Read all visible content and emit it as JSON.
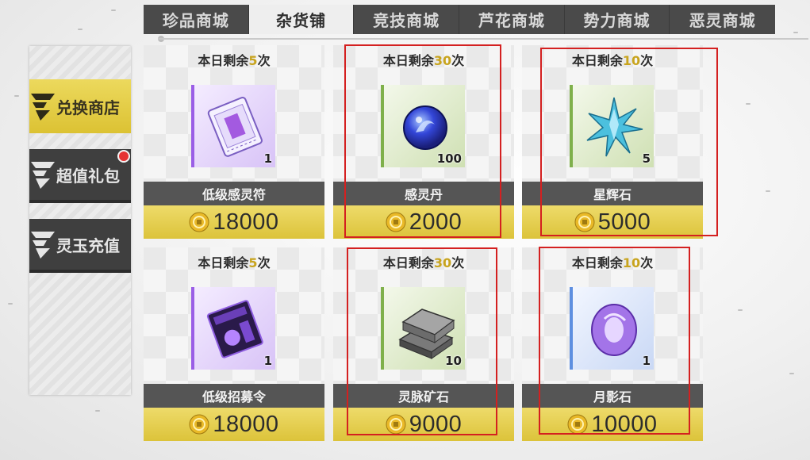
{
  "tabs": [
    {
      "label": "珍品商城"
    },
    {
      "label": "杂货铺"
    },
    {
      "label": "竞技商城"
    },
    {
      "label": "芦花商城"
    },
    {
      "label": "势力商城"
    },
    {
      "label": "恶灵商城"
    }
  ],
  "active_tab": "杂货铺",
  "sidebar": {
    "items": [
      {
        "label": "兑换商店",
        "state": "active"
      },
      {
        "label": "超值礼包",
        "state": "notification"
      },
      {
        "label": "灵玉充值",
        "state": "normal"
      }
    ]
  },
  "remaining_prefix": "本日剩余",
  "remaining_suffix": "次",
  "items": [
    {
      "remaining": "5",
      "icon": "ticket-icon",
      "qty": "1",
      "name": "低级感灵符",
      "price": "18000"
    },
    {
      "remaining": "30",
      "icon": "blue-orb-icon",
      "qty": "100",
      "name": "感灵丹",
      "price": "2000"
    },
    {
      "remaining": "10",
      "icon": "star-crystal-icon",
      "qty": "5",
      "name": "星辉石",
      "price": "5000"
    },
    {
      "remaining": "5",
      "icon": "summon-card-icon",
      "qty": "1",
      "name": "低级招募令",
      "price": "18000"
    },
    {
      "remaining": "30",
      "icon": "ore-ingot-icon",
      "qty": "10",
      "name": "灵脉矿石",
      "price": "9000"
    },
    {
      "remaining": "10",
      "icon": "moon-stone-icon",
      "qty": "1",
      "name": "月影石",
      "price": "10000"
    }
  ],
  "colors": {
    "accent_gold": "#dcc233",
    "tab_bar": "#4a4a4a",
    "highlight_box": "#d42020"
  }
}
